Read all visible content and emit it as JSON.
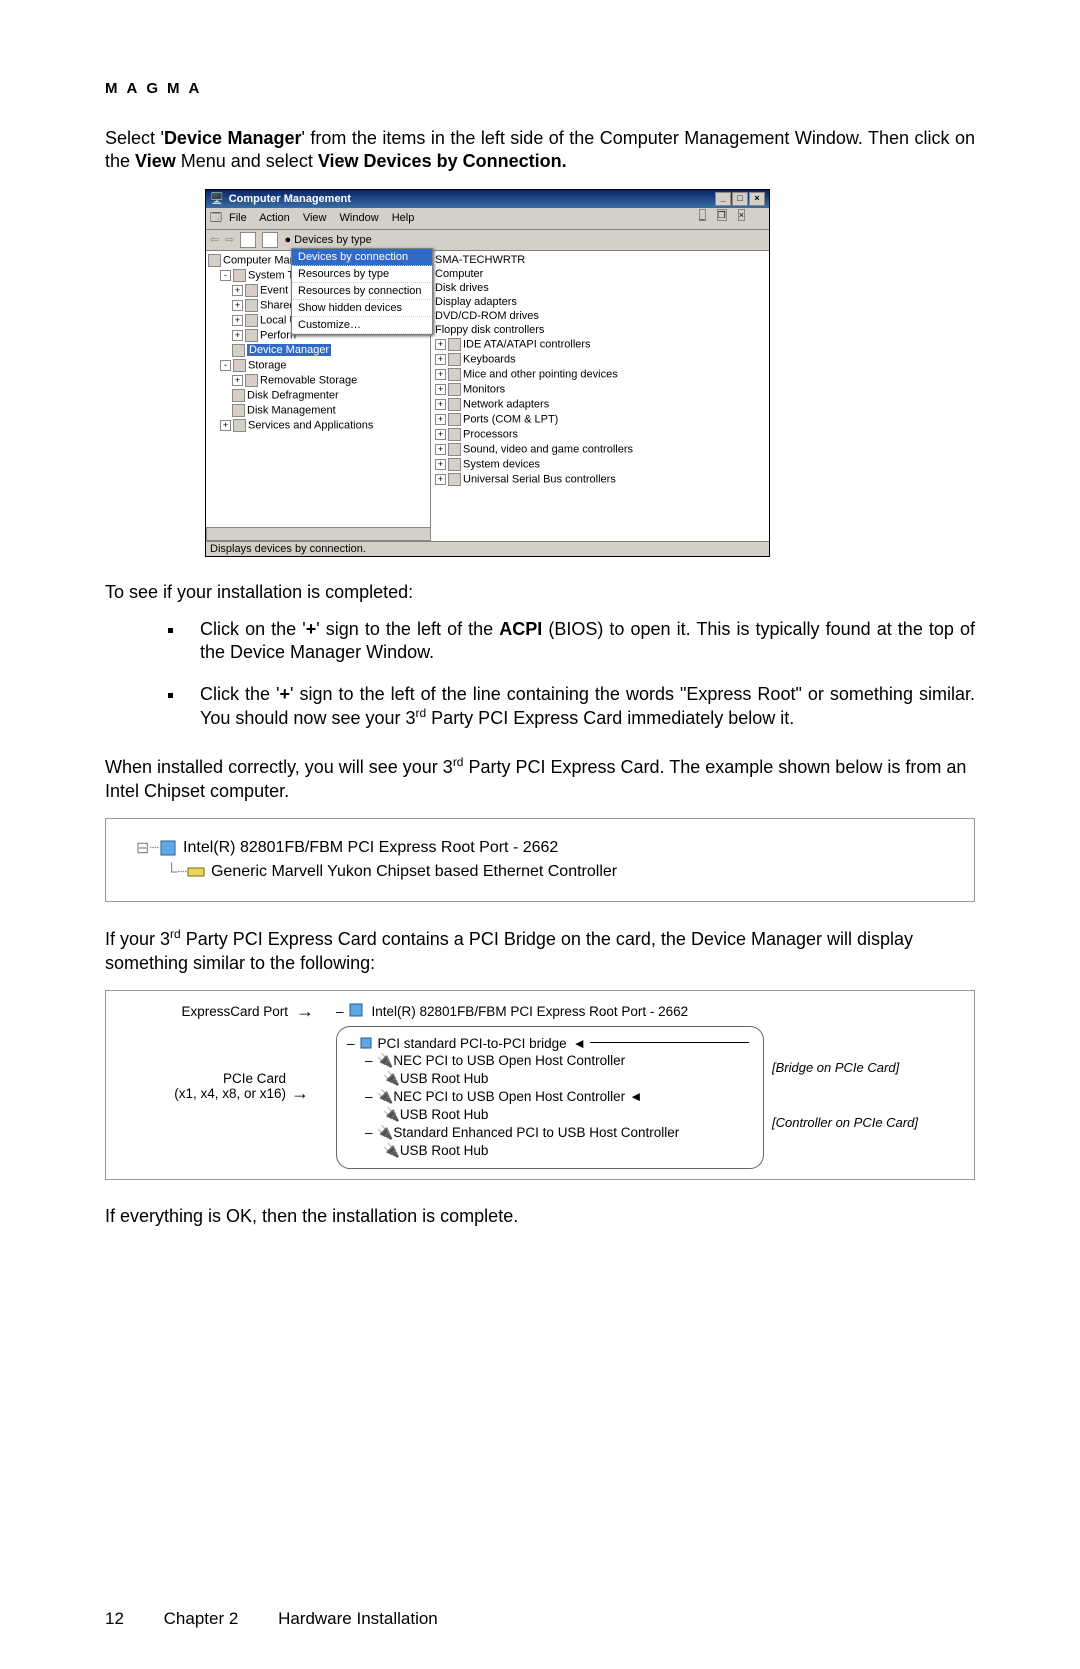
{
  "header": "MAGMA",
  "p1": {
    "t1": "Select '",
    "b1": "Device Manager",
    "t2": "' from the items in the left side of the Computer Management Window. Then click on the ",
    "b2": "View",
    "t3": " Menu and select ",
    "b3": "View Devices by Connection."
  },
  "screenshot": {
    "title": "Computer Management",
    "menus": [
      "File",
      "Action",
      "View",
      "Window",
      "Help"
    ],
    "toolbar_radio": "Devices by type",
    "dropdown": {
      "items": [
        "Devices by connection",
        "Resources by type",
        "Resources by connection",
        "Show hidden devices",
        "Customize…"
      ],
      "selected": 0
    },
    "left_tree": [
      "Computer Mana",
      "System Too",
      "Event V",
      "Shared",
      "Local U",
      "Perforn",
      "Device Manager",
      "Storage",
      "Removable Storage",
      "Disk Defragmenter",
      "Disk Management",
      "Services and Applications"
    ],
    "right_tree": [
      "SMA-TECHWRTR",
      "Computer",
      "Disk drives",
      "Display adapters",
      "DVD/CD-ROM drives",
      "Floppy disk controllers",
      "IDE ATA/ATAPI controllers",
      "Keyboards",
      "Mice and other pointing devices",
      "Monitors",
      "Network adapters",
      "Ports (COM & LPT)",
      "Processors",
      "Sound, video and game controllers",
      "System devices",
      "Universal Serial Bus controllers"
    ],
    "status": "Displays devices by connection."
  },
  "check_text": "To see if your installation is completed:",
  "bullets": {
    "b1": {
      "t1": "Click on the '",
      "plus": "+",
      "t2": "' sign to the left of the ",
      "b": "ACPI",
      "t3": " (BIOS) to open it. This is typically found at the top of the Device Manager Window."
    },
    "b2": {
      "t1": "Click the '",
      "plus": "+",
      "t2": "' sign to the left of the line containing the words \"Express Root\" or something similar. You should now see your 3",
      "rd": "rd",
      "t3": " Party PCI Express Card immediately below it."
    }
  },
  "p2": {
    "t1": "When installed correctly, you will see your 3",
    "rd": "rd",
    "t2": " Party PCI Express Card. The example shown below is from an Intel Chipset computer."
  },
  "diagram1": {
    "l1": "Intel(R) 82801FB/FBM PCI Express Root Port - 2662",
    "l2": "Generic Marvell Yukon Chipset based Ethernet Controller"
  },
  "p3": {
    "t1": "If your 3",
    "rd": "rd",
    "t2": " Party PCI Express Card contains a PCI Bridge on the card, the Device Manager will display something similar to the following:"
  },
  "diagram2": {
    "label1": "ExpressCard Port",
    "label2a": "PCIe Card",
    "label2b": "(x1, x4, x8, or x16)",
    "anno1": "[Bridge on PCIe Card]",
    "anno2": "[Controller on PCIe Card]",
    "root": "Intel(R) 82801FB/FBM PCI Express Root Port - 2662",
    "bridge": "PCI standard PCI-to-PCI bridge",
    "c1": "NEC PCI to USB Open Host Controller",
    "usb": "USB Root Hub",
    "c2": "NEC PCI to USB Open Host Controller",
    "c3": "Standard Enhanced PCI to USB Host Controller"
  },
  "p4": "If everything is OK, then the installation is complete.",
  "footer": {
    "page": "12",
    "chapter": "Chapter 2",
    "title": "Hardware Installation"
  }
}
